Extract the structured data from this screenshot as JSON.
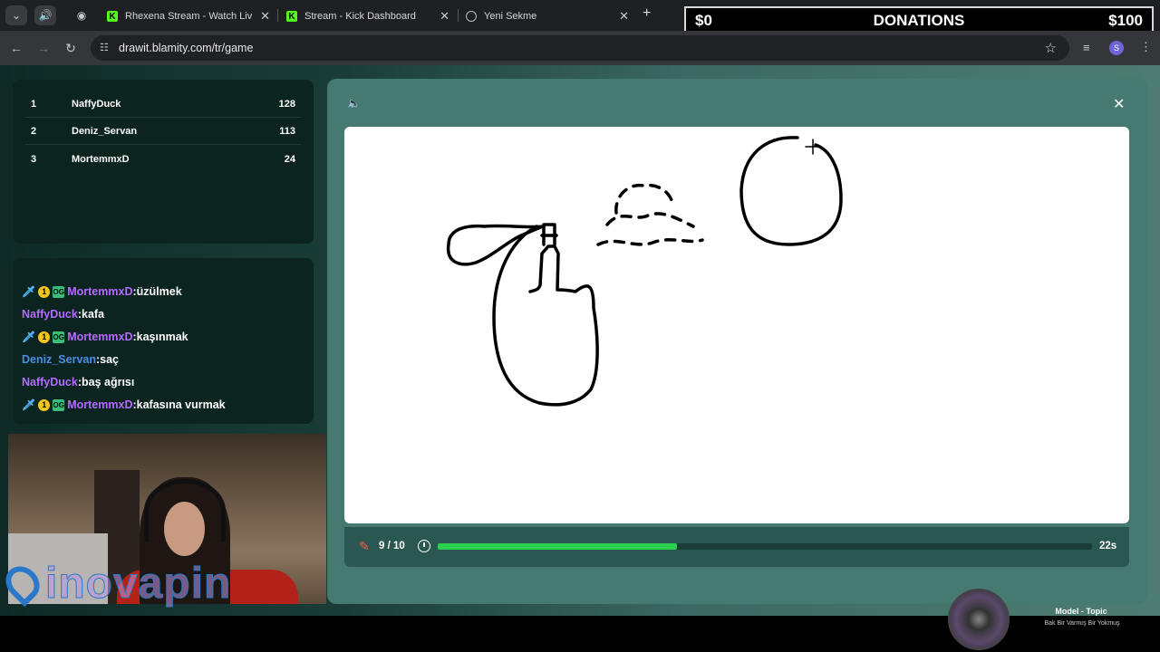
{
  "browser": {
    "tabs": [
      {
        "title": "Rhexena Stream - Watch Live o"
      },
      {
        "title": "Stream - Kick Dashboard"
      },
      {
        "title": "Yeni Sekme"
      }
    ],
    "url": "drawit.blamity.com/tr/game",
    "profile_initial": "S"
  },
  "donations": {
    "min": "$0",
    "label": "DONATIONS",
    "max": "$100"
  },
  "leaderboard": [
    {
      "rank": "1",
      "name": "NaffyDuck",
      "score": "128"
    },
    {
      "rank": "2",
      "name": "Deniz_Servan",
      "score": "113"
    },
    {
      "rank": "3",
      "name": "MortemmxD",
      "score": "24"
    }
  ],
  "chat": [
    {
      "badges": true,
      "user": "MortemmxD",
      "color": "#b46bff",
      "text": "üzülmek"
    },
    {
      "badges": false,
      "user": "NaffyDuck",
      "color": "#b46bff",
      "text": "kafa"
    },
    {
      "badges": true,
      "user": "MortemmxD",
      "color": "#b46bff",
      "text": "kaşınmak"
    },
    {
      "badges": false,
      "user": "Deniz_Servan",
      "color": "#4a8ee8",
      "text": "saç"
    },
    {
      "badges": false,
      "user": "NaffyDuck",
      "color": "#b46bff",
      "text": "baş ağrısı"
    },
    {
      "badges": true,
      "user": "MortemmxD",
      "color": "#b46bff",
      "text": "kafasına vurmak"
    }
  ],
  "game": {
    "round": "9 / 10",
    "time_left": "22s",
    "progress_fraction": 0.365,
    "progress_color": "#2ad24f"
  },
  "overlay": {
    "brand": "inovapin",
    "music_title": "Model - Topic",
    "music_subtitle": "Bak Bir Varmış Bir Yokmuş"
  }
}
